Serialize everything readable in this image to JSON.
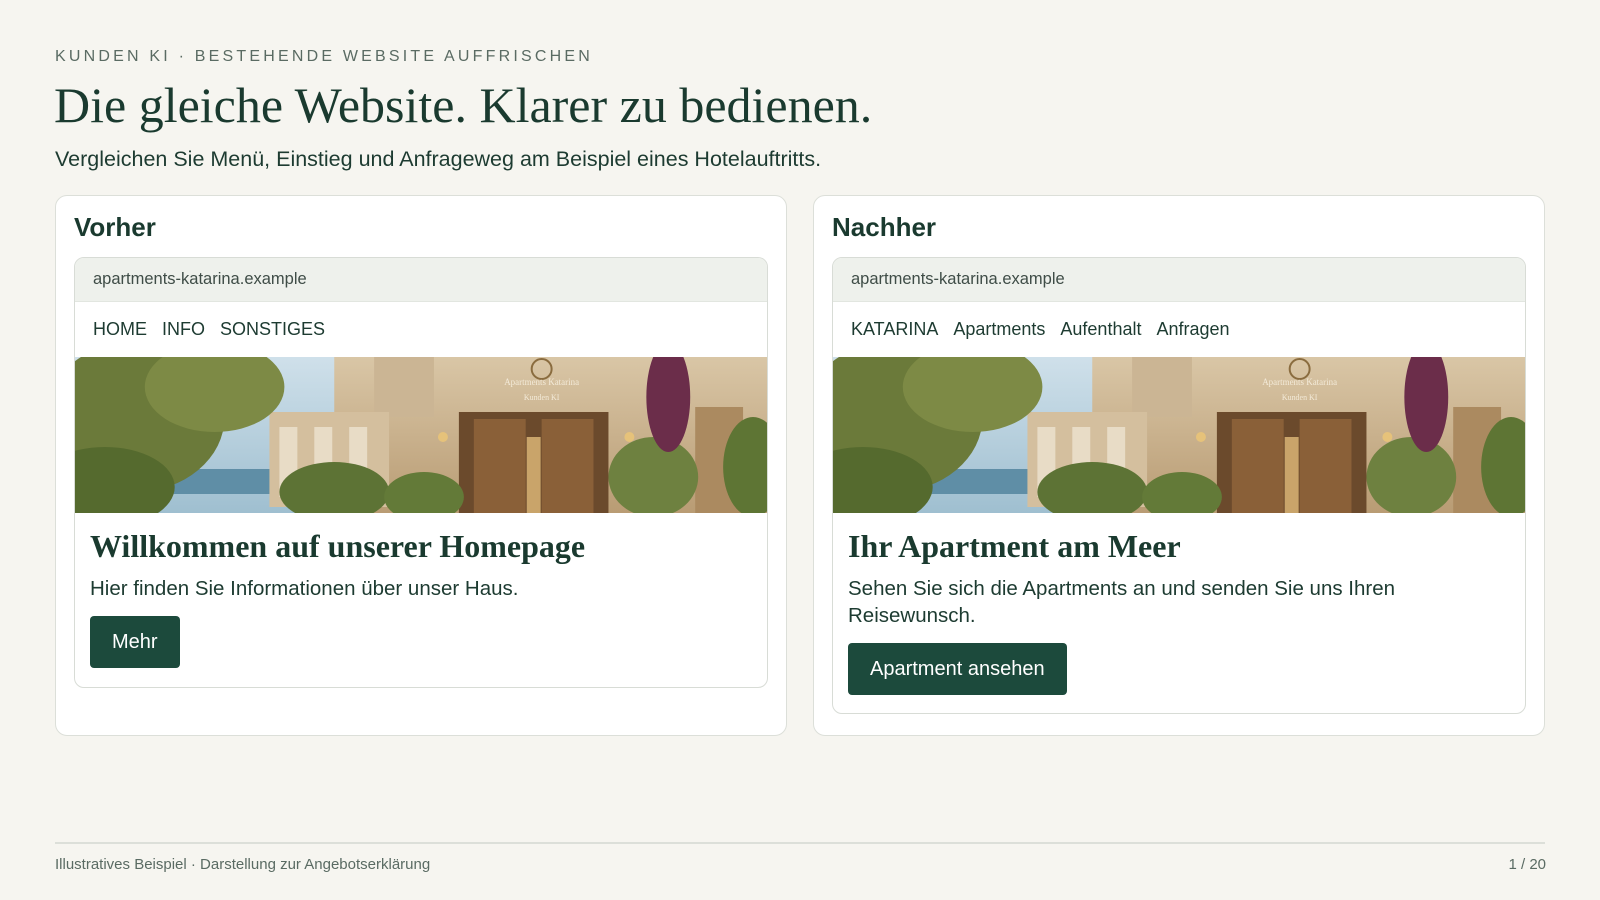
{
  "header": {
    "eyebrow": "KUNDEN KI · BESTEHENDE WEBSITE AUFFRISCHEN",
    "title": "Die gleiche Website. Klarer zu bedienen.",
    "subtitle": "Vergleichen Sie Menü, Einstieg und Anfrageweg am Beispiel eines Hotelauftritts."
  },
  "before": {
    "heading": "Vorher",
    "url": "apartments-katarina.example",
    "nav": [
      "HOME",
      "INFO",
      "SONSTIGES"
    ],
    "hero_sign": [
      "Apartments Katarina",
      "Kunden KI"
    ],
    "headline": "Willkommen auf unserer Homepage",
    "description": "Hier finden Sie Informationen über unser Haus.",
    "button": "Mehr"
  },
  "after": {
    "heading": "Nachher",
    "url": "apartments-katarina.example",
    "nav": [
      "KATARINA",
      "Apartments",
      "Aufenthalt",
      "Anfragen"
    ],
    "hero_sign": [
      "Apartments Katarina",
      "Kunden KI"
    ],
    "headline": "Ihr Apartment am Meer",
    "description": "Sehen Sie sich die Apartments an und senden Sie uns Ihren Reisewunsch.",
    "button": "Apartment ansehen"
  },
  "footer": {
    "note": "Illustratives Beispiel · Darstellung zur Angebotserklärung",
    "page": "1 / 20"
  },
  "colors": {
    "background": "#f6f5f0",
    "primary_green": "#1c4a3c",
    "text_dark": "#1a3a2f"
  }
}
